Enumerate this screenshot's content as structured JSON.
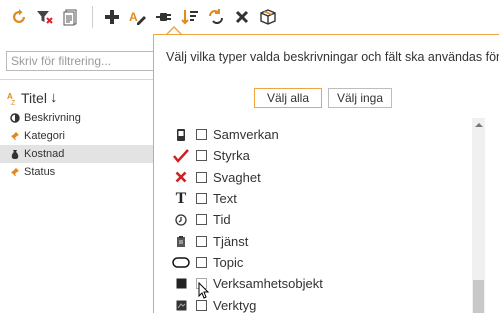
{
  "toolbar": {
    "icons": [
      "refresh-icon",
      "filter-clear-icon",
      "document-icon",
      "add-icon",
      "edit-text-icon",
      "plug-icon",
      "sort-icon",
      "replace-icon",
      "delete-icon",
      "package-icon"
    ]
  },
  "left_pane": {
    "search_placeholder": "Skriv för filtrering...",
    "column_header": "Titel",
    "items": [
      {
        "label": "Beskrivning",
        "icon": "description-icon",
        "selected": false
      },
      {
        "label": "Kategori",
        "icon": "pin-icon",
        "selected": false
      },
      {
        "label": "Kostnad",
        "icon": "money-bag-icon",
        "selected": true
      },
      {
        "label": "Status",
        "icon": "pin-icon",
        "selected": false
      }
    ]
  },
  "popup": {
    "title": "Välj vilka typer valda beskrivningar och fält ska användas för",
    "select_all_label": "Välj alla",
    "select_none_label": "Välj inga",
    "types": [
      {
        "label": "Samverkan",
        "icon": "device-icon",
        "checked": false
      },
      {
        "label": "Styrka",
        "icon": "check-mark-icon",
        "checked": false
      },
      {
        "label": "Svaghet",
        "icon": "cross-mark-icon",
        "checked": false
      },
      {
        "label": "Text",
        "icon": "text-t-icon",
        "checked": false
      },
      {
        "label": "Tid",
        "icon": "clock-icon",
        "checked": false
      },
      {
        "label": "Tjänst",
        "icon": "clipboard-icon",
        "checked": false
      },
      {
        "label": "Topic",
        "icon": "rounded-rect-icon",
        "checked": false
      },
      {
        "label": "Verksamhetsobjekt",
        "icon": "black-square-icon",
        "checked": false
      },
      {
        "label": "Verktyg",
        "icon": "tool-image-icon",
        "checked": false
      }
    ]
  },
  "colors": {
    "accent": "#f0a540",
    "selected_row": "#e3e3e3"
  }
}
